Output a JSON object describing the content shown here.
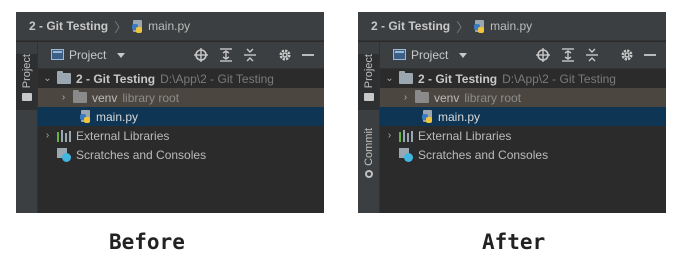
{
  "panels": [
    {
      "breadcrumb": {
        "project": "2 - Git Testing",
        "file": "main.py"
      },
      "side_tabs": [
        "Project"
      ],
      "toolbar": {
        "view": "Project"
      },
      "tree": {
        "root": {
          "name": "2 - Git Testing",
          "path": "D:\\App\\2 - Git Testing"
        },
        "venv": {
          "name": "venv",
          "note": "library root"
        },
        "file": "main.py",
        "external": "External Libraries",
        "scratches": "Scratches and Consoles"
      },
      "caption": "Before"
    },
    {
      "breadcrumb": {
        "project": "2 - Git Testing",
        "file": "main.py"
      },
      "side_tabs": [
        "Project",
        "Commit"
      ],
      "toolbar": {
        "view": "Project"
      },
      "tree": {
        "root": {
          "name": "2 - Git Testing",
          "path": "D:\\App\\2 - Git Testing"
        },
        "venv": {
          "name": "venv",
          "note": "library root"
        },
        "file": "main.py",
        "external": "External Libraries",
        "scratches": "Scratches and Consoles"
      },
      "caption": "After"
    }
  ],
  "icons": {
    "locate": "crosshair-icon",
    "expand_all": "expand-all-icon",
    "collapse_all": "collapse-all-icon",
    "settings": "gear-icon",
    "hide": "minimize-icon"
  },
  "colors": {
    "background": "#2b2b2b",
    "toolbar": "#3c3f41",
    "venv_row": "#4b4740",
    "selected_row": "#0e3553"
  }
}
